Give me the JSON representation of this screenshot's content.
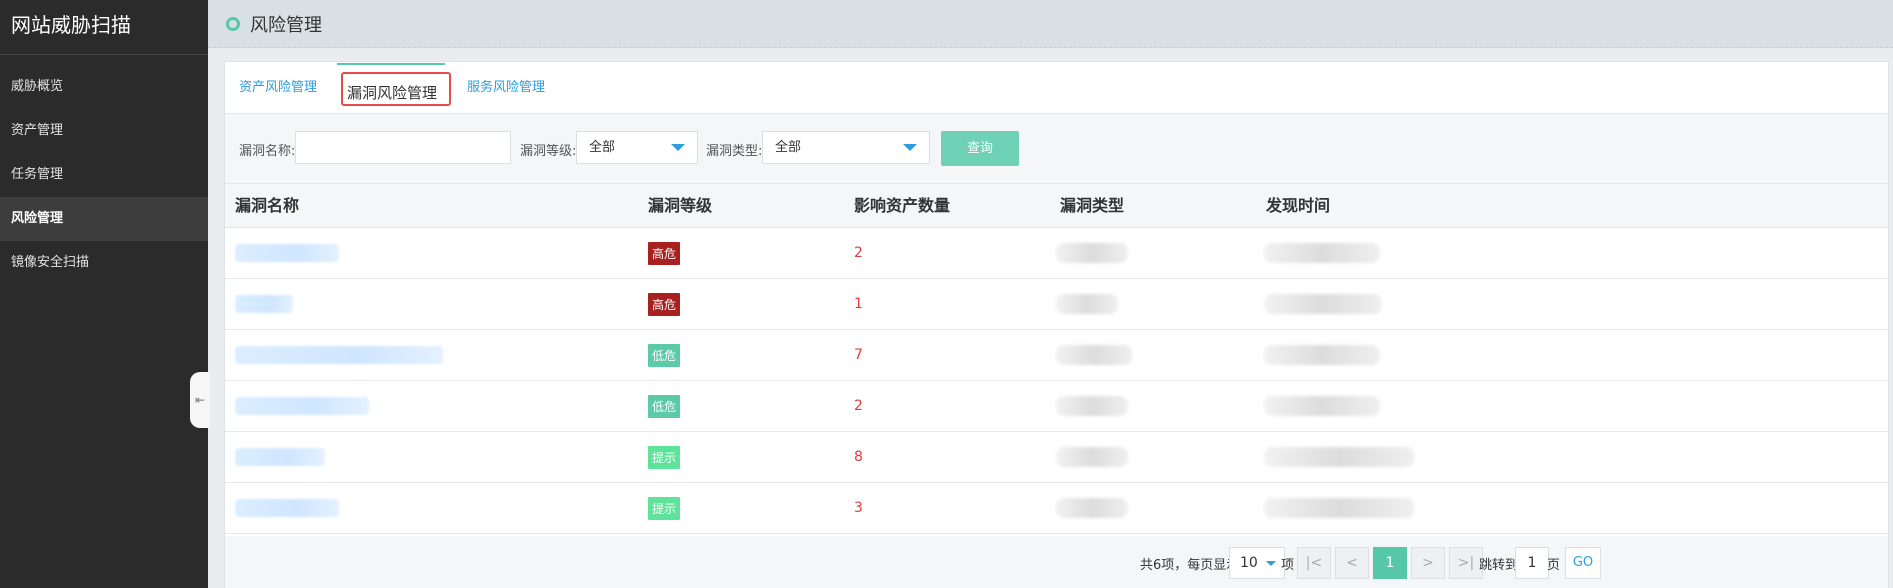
{
  "app": {
    "title": "网站威胁扫描"
  },
  "sidebar": {
    "items": [
      {
        "label": "威胁概览"
      },
      {
        "label": "资产管理"
      },
      {
        "label": "任务管理"
      },
      {
        "label": "风险管理",
        "active": true
      },
      {
        "label": "镜像安全扫描"
      }
    ]
  },
  "header": {
    "title": "风险管理"
  },
  "tabs": [
    {
      "label": "资产风险管理"
    },
    {
      "label": "漏洞风险管理",
      "active": true
    },
    {
      "label": "服务风险管理"
    }
  ],
  "filter": {
    "name_label": "漏洞名称:",
    "name_value": "",
    "level_label": "漏洞等级:",
    "level_value": "全部",
    "type_label": "漏洞类型:",
    "type_value": "全部",
    "query_button": "查询"
  },
  "table": {
    "columns": [
      "漏洞名称",
      "漏洞等级",
      "影响资产数量",
      "漏洞类型",
      "发现时间"
    ],
    "rows": [
      {
        "level": "高危",
        "level_color": "#a82020",
        "count": "2"
      },
      {
        "level": "高危",
        "level_color": "#a82020",
        "count": "1"
      },
      {
        "level": "低危",
        "level_color": "#5cc9a7",
        "count": "7"
      },
      {
        "level": "低危",
        "level_color": "#5cc9a7",
        "count": "2"
      },
      {
        "level": "提示",
        "level_color": "#5fe39b",
        "count": "8"
      },
      {
        "level": "提示",
        "level_color": "#5fe39b",
        "count": "3"
      }
    ]
  },
  "pager": {
    "summary": "共6项，每页显示",
    "page_size": "10",
    "unit": "项",
    "first": "|<",
    "prev": "<",
    "current": "1",
    "next": ">",
    "last": ">|",
    "jump_label": "跳转到",
    "jump_value": "1",
    "page_unit": "页",
    "go": "GO"
  },
  "colors": {
    "accent": "#56c8a8",
    "link": "#2a9ede",
    "count": "#e03c3c",
    "highlight_box": "#e74c4c"
  }
}
